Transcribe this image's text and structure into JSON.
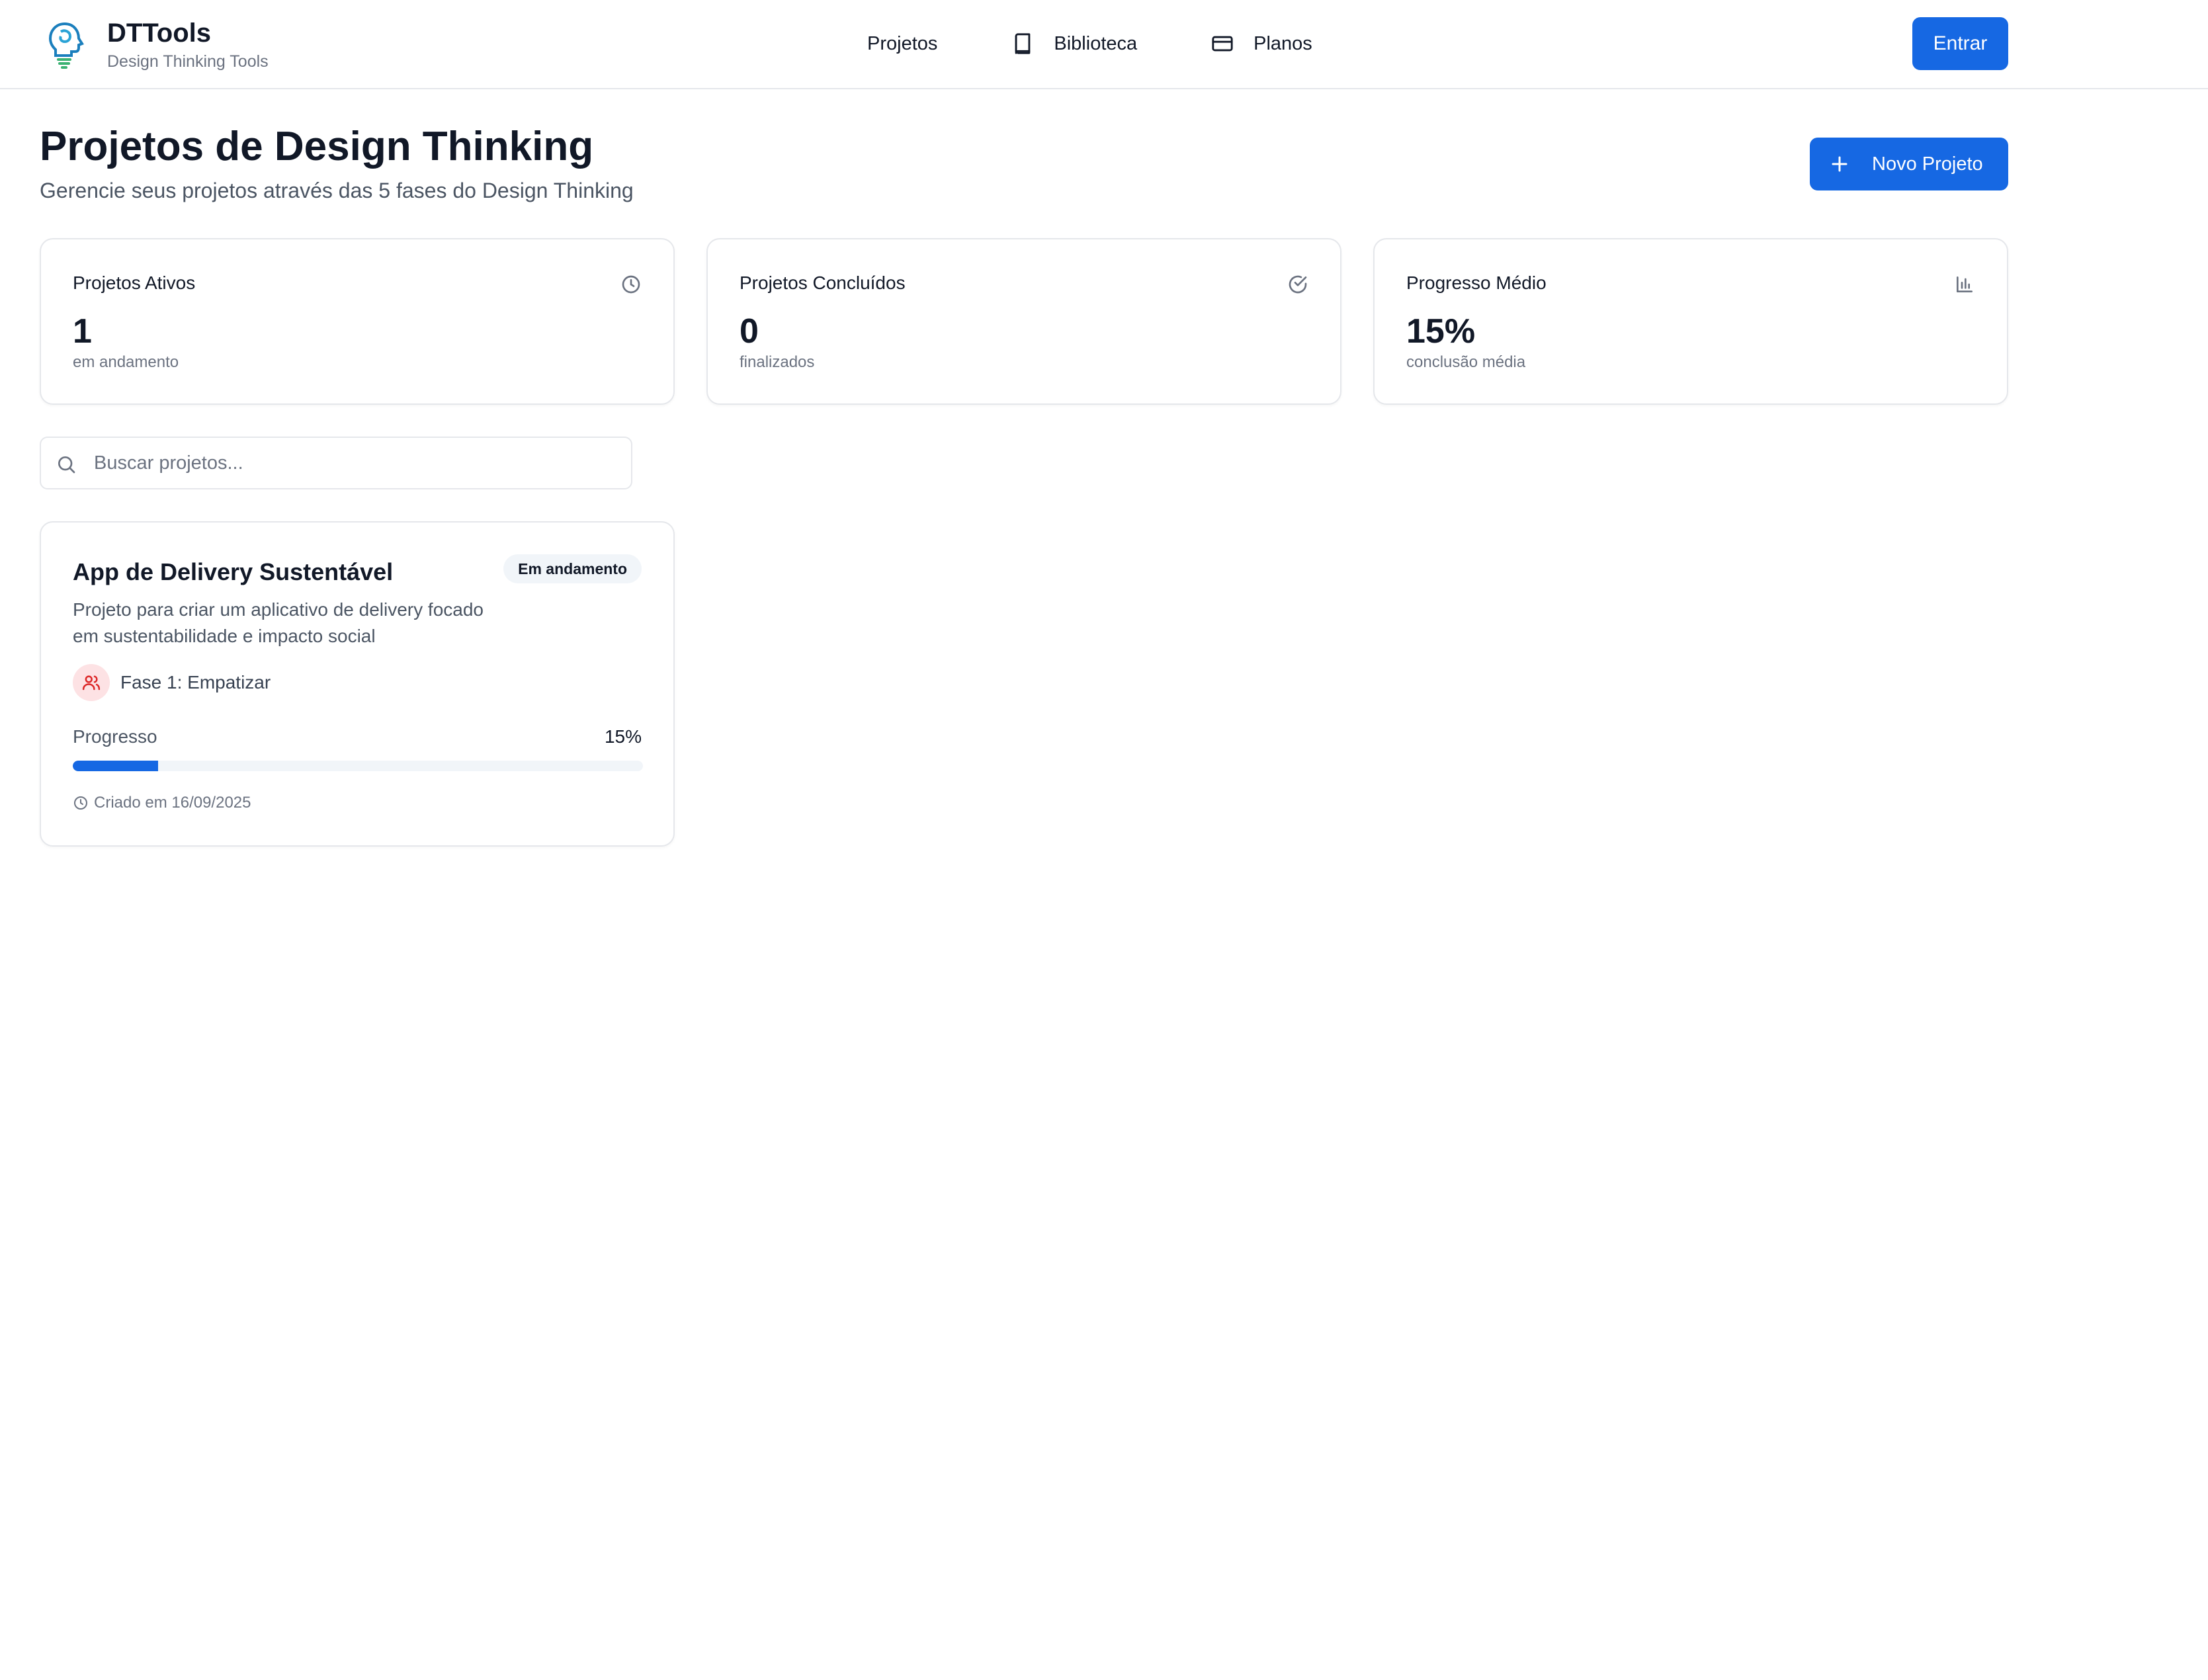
{
  "header": {
    "brand_title": "DTTools",
    "brand_subtitle": "Design Thinking Tools",
    "nav": [
      {
        "label": "Projetos",
        "icon": "none"
      },
      {
        "label": "Biblioteca",
        "icon": "book-icon"
      },
      {
        "label": "Planos",
        "icon": "credit-card-icon"
      }
    ],
    "login_label": "Entrar"
  },
  "page": {
    "title": "Projetos de Design Thinking",
    "subtitle": "Gerencie seus projetos através das 5 fases do Design Thinking",
    "new_project_label": "Novo Projeto"
  },
  "stats": [
    {
      "label": "Projetos Ativos",
      "value": "1",
      "caption": "em andamento",
      "icon": "clock-icon"
    },
    {
      "label": "Projetos Concluídos",
      "value": "0",
      "caption": "finalizados",
      "icon": "check-circle-icon"
    },
    {
      "label": "Progresso Médio",
      "value": "15%",
      "caption": "conclusão média",
      "icon": "bar-chart-icon"
    }
  ],
  "search": {
    "placeholder": "Buscar projetos...",
    "value": ""
  },
  "projects": [
    {
      "title": "App de Delivery Sustentável",
      "status": "Em andamento",
      "description": "Projeto para criar um aplicativo de delivery focado em sustentabilidade e impacto social",
      "phase": "Fase 1: Empatizar",
      "progress_label": "Progresso",
      "progress_text": "15%",
      "progress": 0.15,
      "created": "Criado em 16/09/2025"
    }
  ],
  "colors": {
    "accent": "#1668e3",
    "phase_bg": "#fde2e4",
    "phase_icon": "#dc2626",
    "badge_bg": "#f1f5f9"
  }
}
